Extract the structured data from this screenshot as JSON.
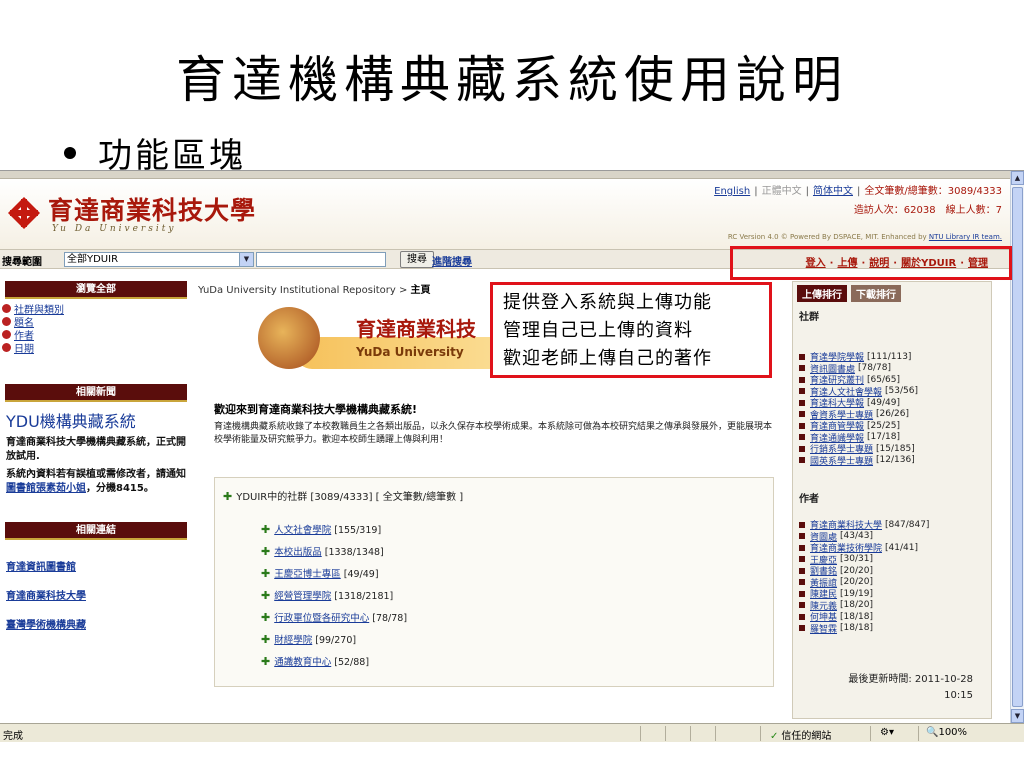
{
  "slide": {
    "title": "育達機構典藏系統使用說明",
    "bullet": "功能區塊"
  },
  "banner": {
    "logo_text": "育達商業科技大學",
    "logo_sub": "Yu Da University",
    "lang_english": "English",
    "lang_traditional": "正體中文",
    "lang_simplified": "简体中文",
    "fulltext_counts": "全文筆數/總筆數：3089/4333",
    "visitors": "造訪人次：62038　線上人數：7",
    "powered": "RC Version 4.0 © Powered By DSPACE, MIT. Enhanced by",
    "powered_link": "NTU Library IR team."
  },
  "searchbar": {
    "label": "搜尋範圍",
    "scope_value": "全部YDUIR",
    "search_button": "搜尋",
    "advanced": "進階搜尋",
    "menu": [
      "登入",
      "上傳",
      "說明",
      "關於YDUIR",
      "管理"
    ]
  },
  "left": {
    "browse_head": "瀏覽全部",
    "browse_items": [
      "社群與類別",
      "題名",
      "作者",
      "日期"
    ],
    "news_head": "相關新聞",
    "news_title": "YDU機構典藏系統",
    "news_p1": "育達商業科技大學機構典藏系統，正式開放試用.",
    "news_p2_prefix": "系統內資料若有誤植或需修改者，請通知",
    "news_p2_link": "圖書館張素茹小姐",
    "news_p2_suffix": "，分機8415。",
    "links_head": "相關連結",
    "links": [
      "育達資訊圖書館",
      "育達商業科技大學",
      "臺灣學術機構典藏"
    ]
  },
  "main": {
    "crumb_prefix": "YuDa University Institutional Repository >",
    "crumb_current": "主頁",
    "center_logo_cn": "育達商業科技",
    "center_logo_en": "YuDa University",
    "welcome": "歡迎來到育達商業科技大學機構典藏系統!",
    "intro": "育達機構典藏系統收錄了本校教職員生之各類出版品，以永久保存本校學術成果。本系統除可做為本校研究結果之傳承與發展外，更能展現本校學術能量及研究競爭力。歡迎本校師生踴躍上傳與利用！",
    "community_head": "YDUIR中的社群 [3089/4333] [ 全文筆數/總筆數 ]",
    "communities": [
      {
        "name": "人文社會學院",
        "count": "[155/319]"
      },
      {
        "name": "本校出版品",
        "count": "[1338/1348]"
      },
      {
        "name": "王慶亞博士專區",
        "count": "[49/49]"
      },
      {
        "name": "經營管理學院",
        "count": "[1318/2181]"
      },
      {
        "name": "行政單位暨各研究中心",
        "count": "[78/78]"
      },
      {
        "name": "財經學院",
        "count": "[99/270]"
      },
      {
        "name": "通識教育中心",
        "count": "[52/88]"
      }
    ]
  },
  "right": {
    "tab_upload": "上傳排行",
    "tab_download": "下載排行",
    "section_community": "社群",
    "community_rank": [
      {
        "name": "育達學院學報",
        "count": "[111/113]"
      },
      {
        "name": "資訊圖書處",
        "count": "[78/78]"
      },
      {
        "name": "育達研究叢刊",
        "count": "[65/65]"
      },
      {
        "name": "育達人文社會學報",
        "count": "[53/56]"
      },
      {
        "name": "育達科大學報",
        "count": "[49/49]"
      },
      {
        "name": "會資系學士專題",
        "count": "[26/26]"
      },
      {
        "name": "育達商管學報",
        "count": "[25/25]"
      },
      {
        "name": "育達通識學報",
        "count": "[17/18]"
      },
      {
        "name": "行銷系學士專題",
        "count": "[15/185]"
      },
      {
        "name": "國英系學士專題",
        "count": "[12/136]"
      }
    ],
    "section_author": "作者",
    "author_rank": [
      {
        "name": "育達商業科技大學",
        "count": "[847/847]"
      },
      {
        "name": "資圖處",
        "count": "[43/43]"
      },
      {
        "name": "育達商業技術學院",
        "count": "[41/41]"
      },
      {
        "name": "王慶亞",
        "count": "[30/31]"
      },
      {
        "name": "劉書銘",
        "count": "[20/20]"
      },
      {
        "name": "黃振誼",
        "count": "[20/20]"
      },
      {
        "name": "陳建民",
        "count": "[19/19]"
      },
      {
        "name": "陳元義",
        "count": "[18/20]"
      },
      {
        "name": "何坤基",
        "count": "[18/18]"
      },
      {
        "name": "羅智霖",
        "count": "[18/18]"
      }
    ],
    "updated_label": "最後更新時間: 2011-10-28",
    "updated_time": "10:15"
  },
  "statusbar": {
    "status": "完成",
    "zone": "信任的網站",
    "zoom": "🔍100%"
  },
  "callout": {
    "lines": [
      "提供登入系統與上傳功能",
      "管理自己已上傳的資料",
      "歡迎老師上傳自己的著作"
    ]
  },
  "colors": {
    "brand_red": "#a8180c",
    "box_head": "#5a0d0c",
    "link_blue": "#1a3c99",
    "callout_red": "#e0121a"
  }
}
